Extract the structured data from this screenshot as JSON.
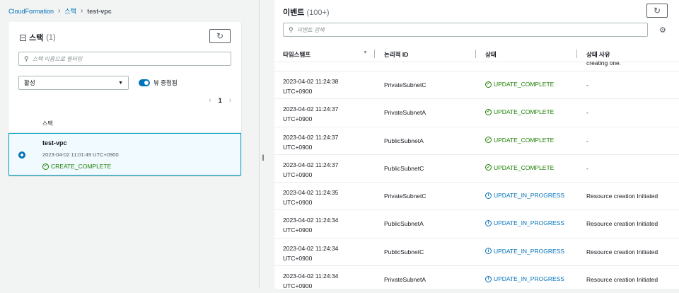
{
  "breadcrumb": {
    "root": "CloudFormation",
    "mid": "스택",
    "current": "test-vpc"
  },
  "left": {
    "title": "스택",
    "count": "(1)",
    "search_placeholder": "스택 이름으로 필터링",
    "filter_value": "활성",
    "toggle_label": "뷰 중첩됨",
    "page": "1",
    "column_header": "스택",
    "stack": {
      "name": "test-vpc",
      "date": "2023-04-02 11:01:49 UTC+0900",
      "status": "CREATE_COMPLETE"
    }
  },
  "right": {
    "title": "이벤트",
    "count": "(100+)",
    "search_placeholder": "이벤트 검색",
    "columns": [
      "타임스탬프",
      "논리적 ID",
      "상태",
      "상태 사유"
    ],
    "partial_reason": "creating one.",
    "events": [
      {
        "date": "2023-04-02 11:24:38",
        "tz": "UTC+0900",
        "id": "PrivateSubnetC",
        "status": "UPDATE_COMPLETE",
        "kind": "ok",
        "reason": "-"
      },
      {
        "date": "2023-04-02 11:24:37",
        "tz": "UTC+0900",
        "id": "PrivateSubnetA",
        "status": "UPDATE_COMPLETE",
        "kind": "ok",
        "reason": "-"
      },
      {
        "date": "2023-04-02 11:24:37",
        "tz": "UTC+0900",
        "id": "PublicSubnetA",
        "status": "UPDATE_COMPLETE",
        "kind": "ok",
        "reason": "-"
      },
      {
        "date": "2023-04-02 11:24:37",
        "tz": "UTC+0900",
        "id": "PublicSubnetC",
        "status": "UPDATE_COMPLETE",
        "kind": "ok",
        "reason": "-"
      },
      {
        "date": "2023-04-02 11:24:35",
        "tz": "UTC+0900",
        "id": "PrivateSubnetC",
        "status": "UPDATE_IN_PROGRESS",
        "kind": "prog",
        "reason": "Resource creation Initiated"
      },
      {
        "date": "2023-04-02 11:24:34",
        "tz": "UTC+0900",
        "id": "PublicSubnetA",
        "status": "UPDATE_IN_PROGRESS",
        "kind": "prog",
        "reason": "Resource creation Initiated"
      },
      {
        "date": "2023-04-02 11:24:34",
        "tz": "UTC+0900",
        "id": "PublicSubnetC",
        "status": "UPDATE_IN_PROGRESS",
        "kind": "prog",
        "reason": "Resource creation Initiated"
      },
      {
        "date": "2023-04-02 11:24:34",
        "tz": "UTC+0900",
        "id": "PrivateSubnetA",
        "status": "UPDATE_IN_PROGRESS",
        "kind": "prog",
        "reason": "Resource creation Initiated"
      }
    ]
  },
  "colors": {
    "link": "#0073bb",
    "success": "#1d8102",
    "progress": "#0073bb",
    "selected_bg": "#f1faff",
    "selected_border": "#00a1c9"
  }
}
